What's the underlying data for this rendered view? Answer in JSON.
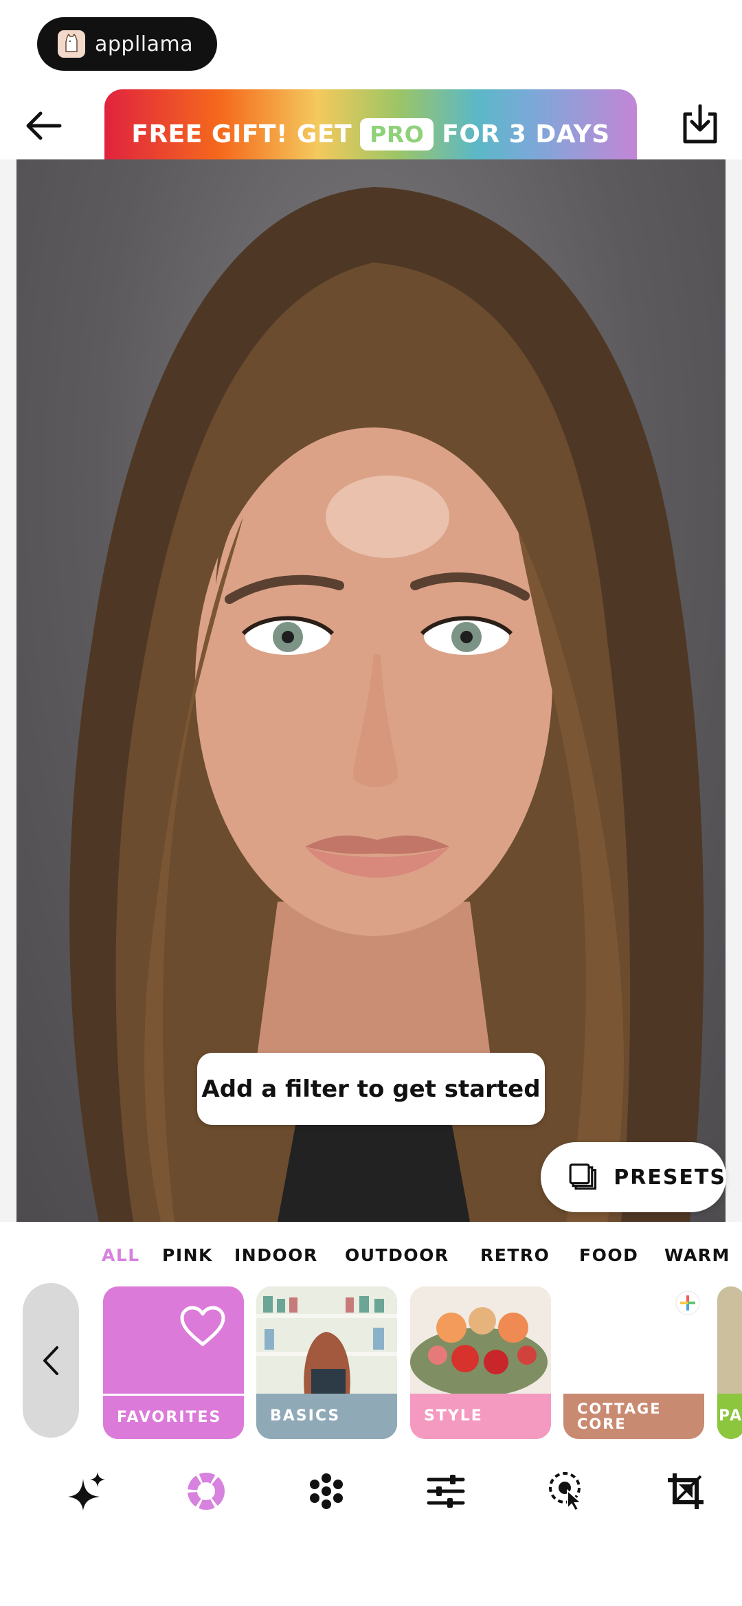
{
  "brand": {
    "name": "appllama"
  },
  "promo": {
    "text_before": "FREE GIFT! GET",
    "badge": "PRO",
    "text_after": "FOR 3 DAYS"
  },
  "hint": {
    "text": "Add a filter to get started"
  },
  "presets": {
    "label": "PRESETS"
  },
  "categories": [
    "ALL",
    "PINK",
    "INDOOR",
    "OUTDOOR",
    "RETRO",
    "FOOD",
    "WARM"
  ],
  "active_category": "ALL",
  "filters": [
    {
      "label": "FAVORITES",
      "color": "#dc7ad9"
    },
    {
      "label": "BASICS",
      "color": "#8fa9b7"
    },
    {
      "label": "STYLE",
      "color": "#f49ac1"
    },
    {
      "label": "COTTAGE CORE",
      "color": "#c98a72"
    },
    {
      "label": "PA",
      "color": "#8cc63f"
    }
  ],
  "toolbar": [
    "sparkle-icon",
    "filters-icon",
    "effects-icon",
    "adjust-icon",
    "retouch-icon",
    "crop-icon"
  ],
  "colors": {
    "accent": "#d682de",
    "promo_pro": "#8fd17a"
  }
}
